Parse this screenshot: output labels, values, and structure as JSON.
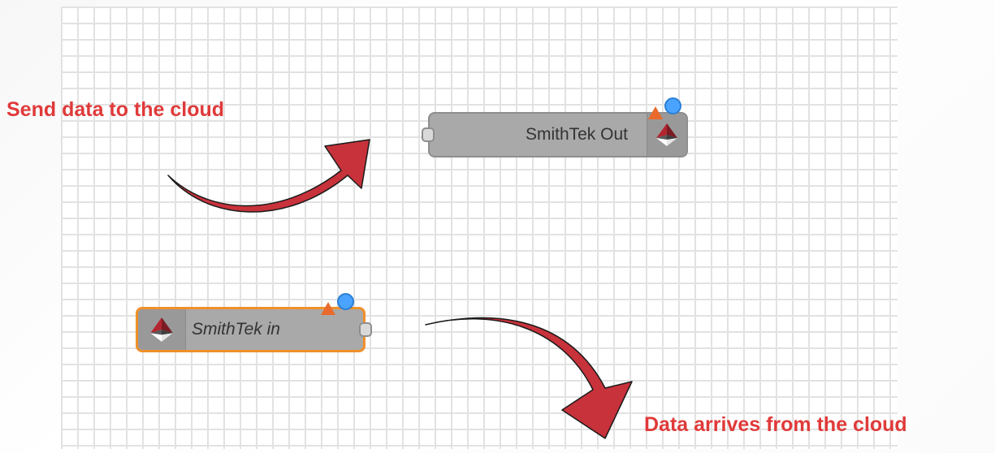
{
  "canvas": {
    "grid_color": "#e2e2e2"
  },
  "nodes": {
    "out": {
      "label": "SmithTek Out",
      "icon": "smithtek-logo-icon",
      "status_icons": [
        "warning-icon",
        "changed-dot-icon"
      ]
    },
    "in": {
      "label": "SmithTek in",
      "icon": "smithtek-logo-icon",
      "status_icons": [
        "warning-icon",
        "changed-dot-icon"
      ],
      "selected": true
    }
  },
  "annotations": {
    "send": "Send data to the cloud",
    "arrive": "Data arrives from the cloud"
  },
  "colors": {
    "annotation": "#e03a3a",
    "arrow_fill": "#c8323b",
    "node_fill": "#a9a9a9",
    "selected_border": "#f0902a",
    "warning": "#ea6a2c",
    "status_dot": "#4aa3ff"
  }
}
